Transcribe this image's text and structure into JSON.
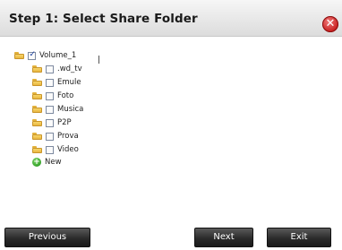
{
  "dialog": {
    "title": "Step 1: Select Share Folder",
    "close_glyph": "✕",
    "close_icon": "close-icon",
    "close_color": "#c81e1e"
  },
  "tree": {
    "root": {
      "label": "Volume_1",
      "checked": true,
      "icon": "folder-icon"
    },
    "children": [
      {
        "label": ".wd_tv",
        "checked": false,
        "icon": "folder-icon"
      },
      {
        "label": "Emule",
        "checked": false,
        "icon": "folder-icon"
      },
      {
        "label": "Foto",
        "checked": false,
        "icon": "folder-icon"
      },
      {
        "label": "Musica",
        "checked": false,
        "icon": "folder-icon"
      },
      {
        "label": "P2P",
        "checked": false,
        "icon": "folder-icon"
      },
      {
        "label": "Prova",
        "checked": false,
        "icon": "folder-icon"
      },
      {
        "label": "Video",
        "checked": false,
        "icon": "folder-icon"
      }
    ],
    "new": {
      "label": "New",
      "icon": "add-icon"
    }
  },
  "buttons": {
    "previous": "Previous",
    "next": "Next",
    "exit": "Exit"
  }
}
